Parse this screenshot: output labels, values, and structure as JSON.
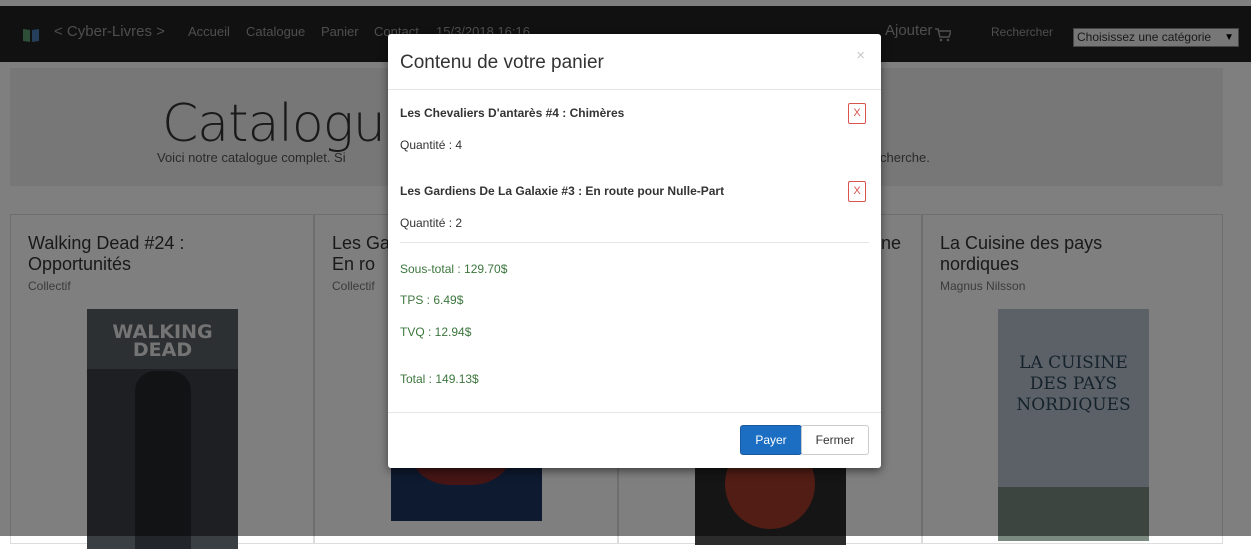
{
  "navbar": {
    "brand": "< Cyber-Livres >",
    "links": [
      "Accueil",
      "Catalogue",
      "Panier",
      "Contact"
    ],
    "datetime": "15/3/2018 16:16",
    "add": "Ajouter",
    "search": "Rechercher",
    "category_select": "Choisissez une catégorie"
  },
  "jumbotron": {
    "title": "Catalogue",
    "subtitle": "Voici notre catalogue complet. Si",
    "subtitle_end": "cherche."
  },
  "books": [
    {
      "title": "Walking Dead #24 : Opportunités",
      "author": "Collectif",
      "cover_text": "WALKING DEAD"
    },
    {
      "title": "Les Ga : En ro",
      "author": "Collectif"
    },
    {
      "title": "ne",
      "author": ""
    },
    {
      "title": "La Cuisine des pays nordiques",
      "author": "Magnus Nilsson",
      "cover_text": "LA CUISINE DES PAYS NORDIQUES"
    }
  ],
  "modal": {
    "title": "Contenu de votre panier",
    "close_icon": "×",
    "remove_label": "X",
    "items": [
      {
        "title": "Les Chevaliers D'antarès #4 : Chimères",
        "quantity": "Quantité : 4"
      },
      {
        "title": "Les Gardiens De La Galaxie #3 : En route pour Nulle-Part",
        "quantity": "Quantité : 2"
      }
    ],
    "subtotal": "Sous-total : 129.70$",
    "tps": "TPS : 6.49$",
    "tvq": "TVQ : 12.94$",
    "total": "Total : 149.13$",
    "pay_button": "Payer",
    "close_button": "Fermer"
  },
  "colors": {
    "navbar": "#222222",
    "primary": "#1b6ec2",
    "danger": "#d9534f",
    "success": "#3c763d"
  }
}
